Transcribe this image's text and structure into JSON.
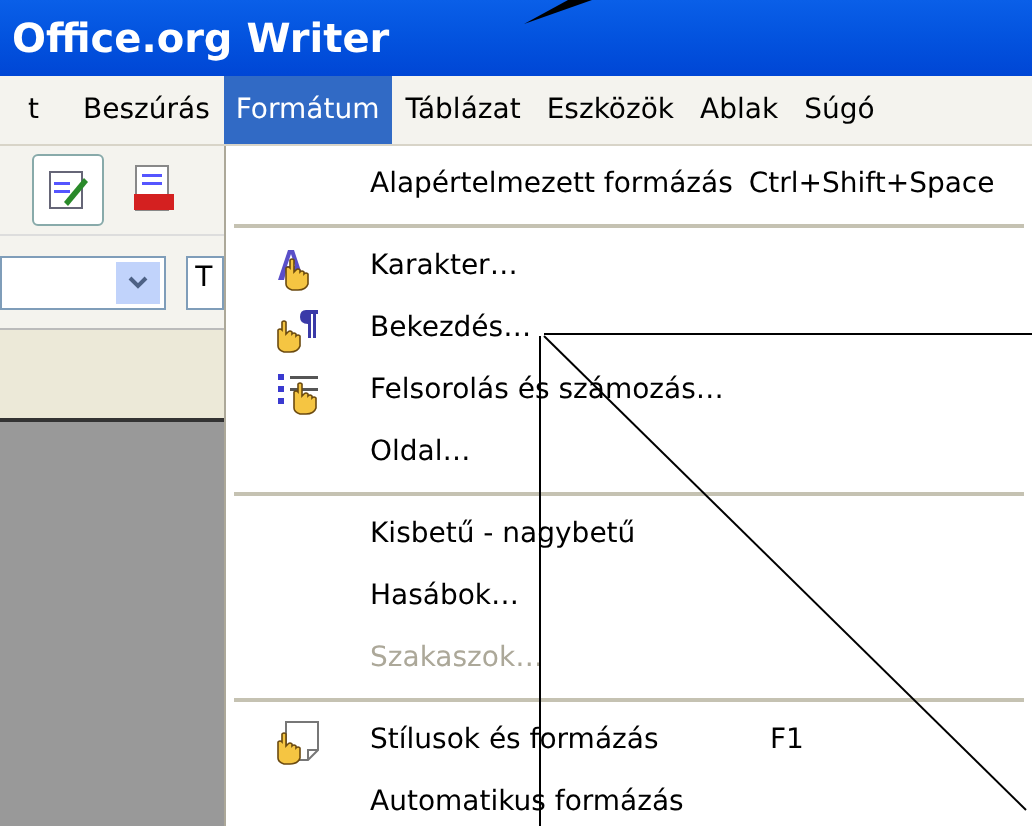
{
  "window": {
    "title": "Office.org Writer"
  },
  "menu_bar": [
    {
      "label": "t",
      "selected": false
    },
    {
      "label": "Beszúrás",
      "selected": false
    },
    {
      "label": "Formátum",
      "selected": true
    },
    {
      "label": "Táblázat",
      "selected": false
    },
    {
      "label": "Eszközök",
      "selected": false
    },
    {
      "label": "Ablak",
      "selected": false
    },
    {
      "label": "Súgó",
      "selected": false
    }
  ],
  "toolbar": {
    "font_field": "T"
  },
  "format_menu": [
    {
      "kind": "item",
      "label": "Alapértelmezett formázás",
      "shortcut": "Ctrl+Shift+Space",
      "disabled": false
    },
    {
      "kind": "separator"
    },
    {
      "kind": "item",
      "label": "Karakter…",
      "disabled": false
    },
    {
      "kind": "item",
      "label": "Bekezdés…",
      "disabled": false
    },
    {
      "kind": "item",
      "label": "Felsorolás és számozás…",
      "disabled": false
    },
    {
      "kind": "item",
      "label": "Oldal…",
      "disabled": false
    },
    {
      "kind": "separator"
    },
    {
      "kind": "item",
      "label": "Kisbetű - nagybetű",
      "disabled": false
    },
    {
      "kind": "item",
      "label": "Hasábok…",
      "disabled": false
    },
    {
      "kind": "item",
      "label": "Szakaszok…",
      "disabled": true
    },
    {
      "kind": "separator"
    },
    {
      "kind": "item",
      "label": "Stílusok és formázás",
      "shortcut": "F1",
      "disabled": false
    },
    {
      "kind": "item",
      "label": "Automatikus formázás",
      "disabled": false
    }
  ]
}
